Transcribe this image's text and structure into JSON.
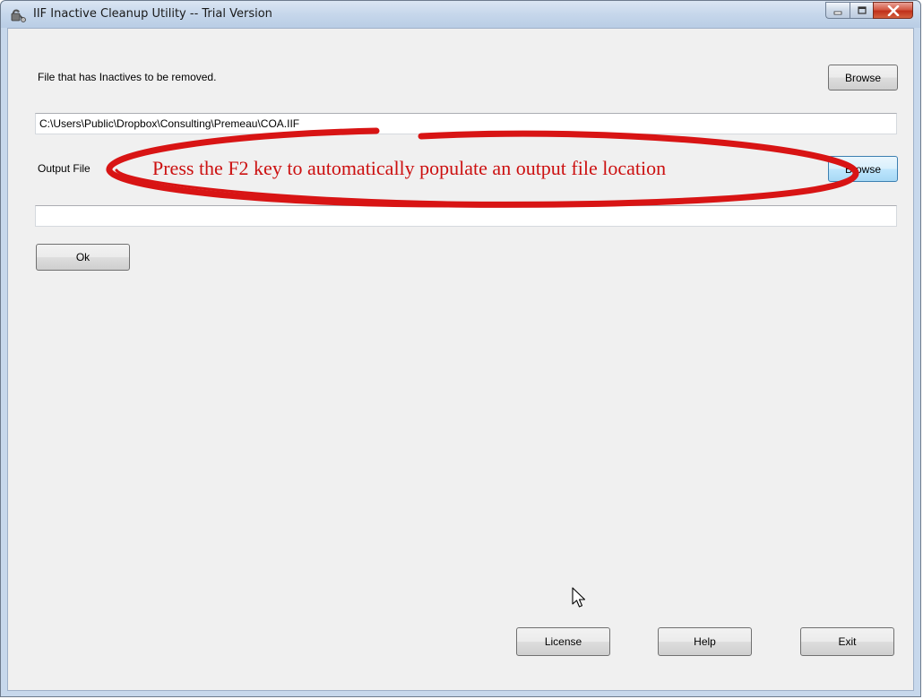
{
  "window": {
    "title": "IIF Inactive Cleanup Utility -- Trial Version"
  },
  "form": {
    "input_label": "File that has Inactives to be removed.",
    "input_browse": "Browse",
    "input_path": "C:\\Users\\Public\\Dropbox\\Consulting\\Premeau\\COA.IIF",
    "output_label": "Output File",
    "output_browse": "Browse",
    "output_path": "",
    "ok": "Ok"
  },
  "footer": {
    "license": "License",
    "help": "Help",
    "exit": "Exit"
  },
  "annotation": {
    "text": "Press the F2 key to automatically populate an output file location",
    "color": "#cc1010"
  },
  "icons": {
    "app": "lock-app-icon",
    "minimize": "minimize-icon",
    "maximize": "maximize-icon",
    "close": "close-icon",
    "cursor": "mouse-cursor-icon"
  }
}
